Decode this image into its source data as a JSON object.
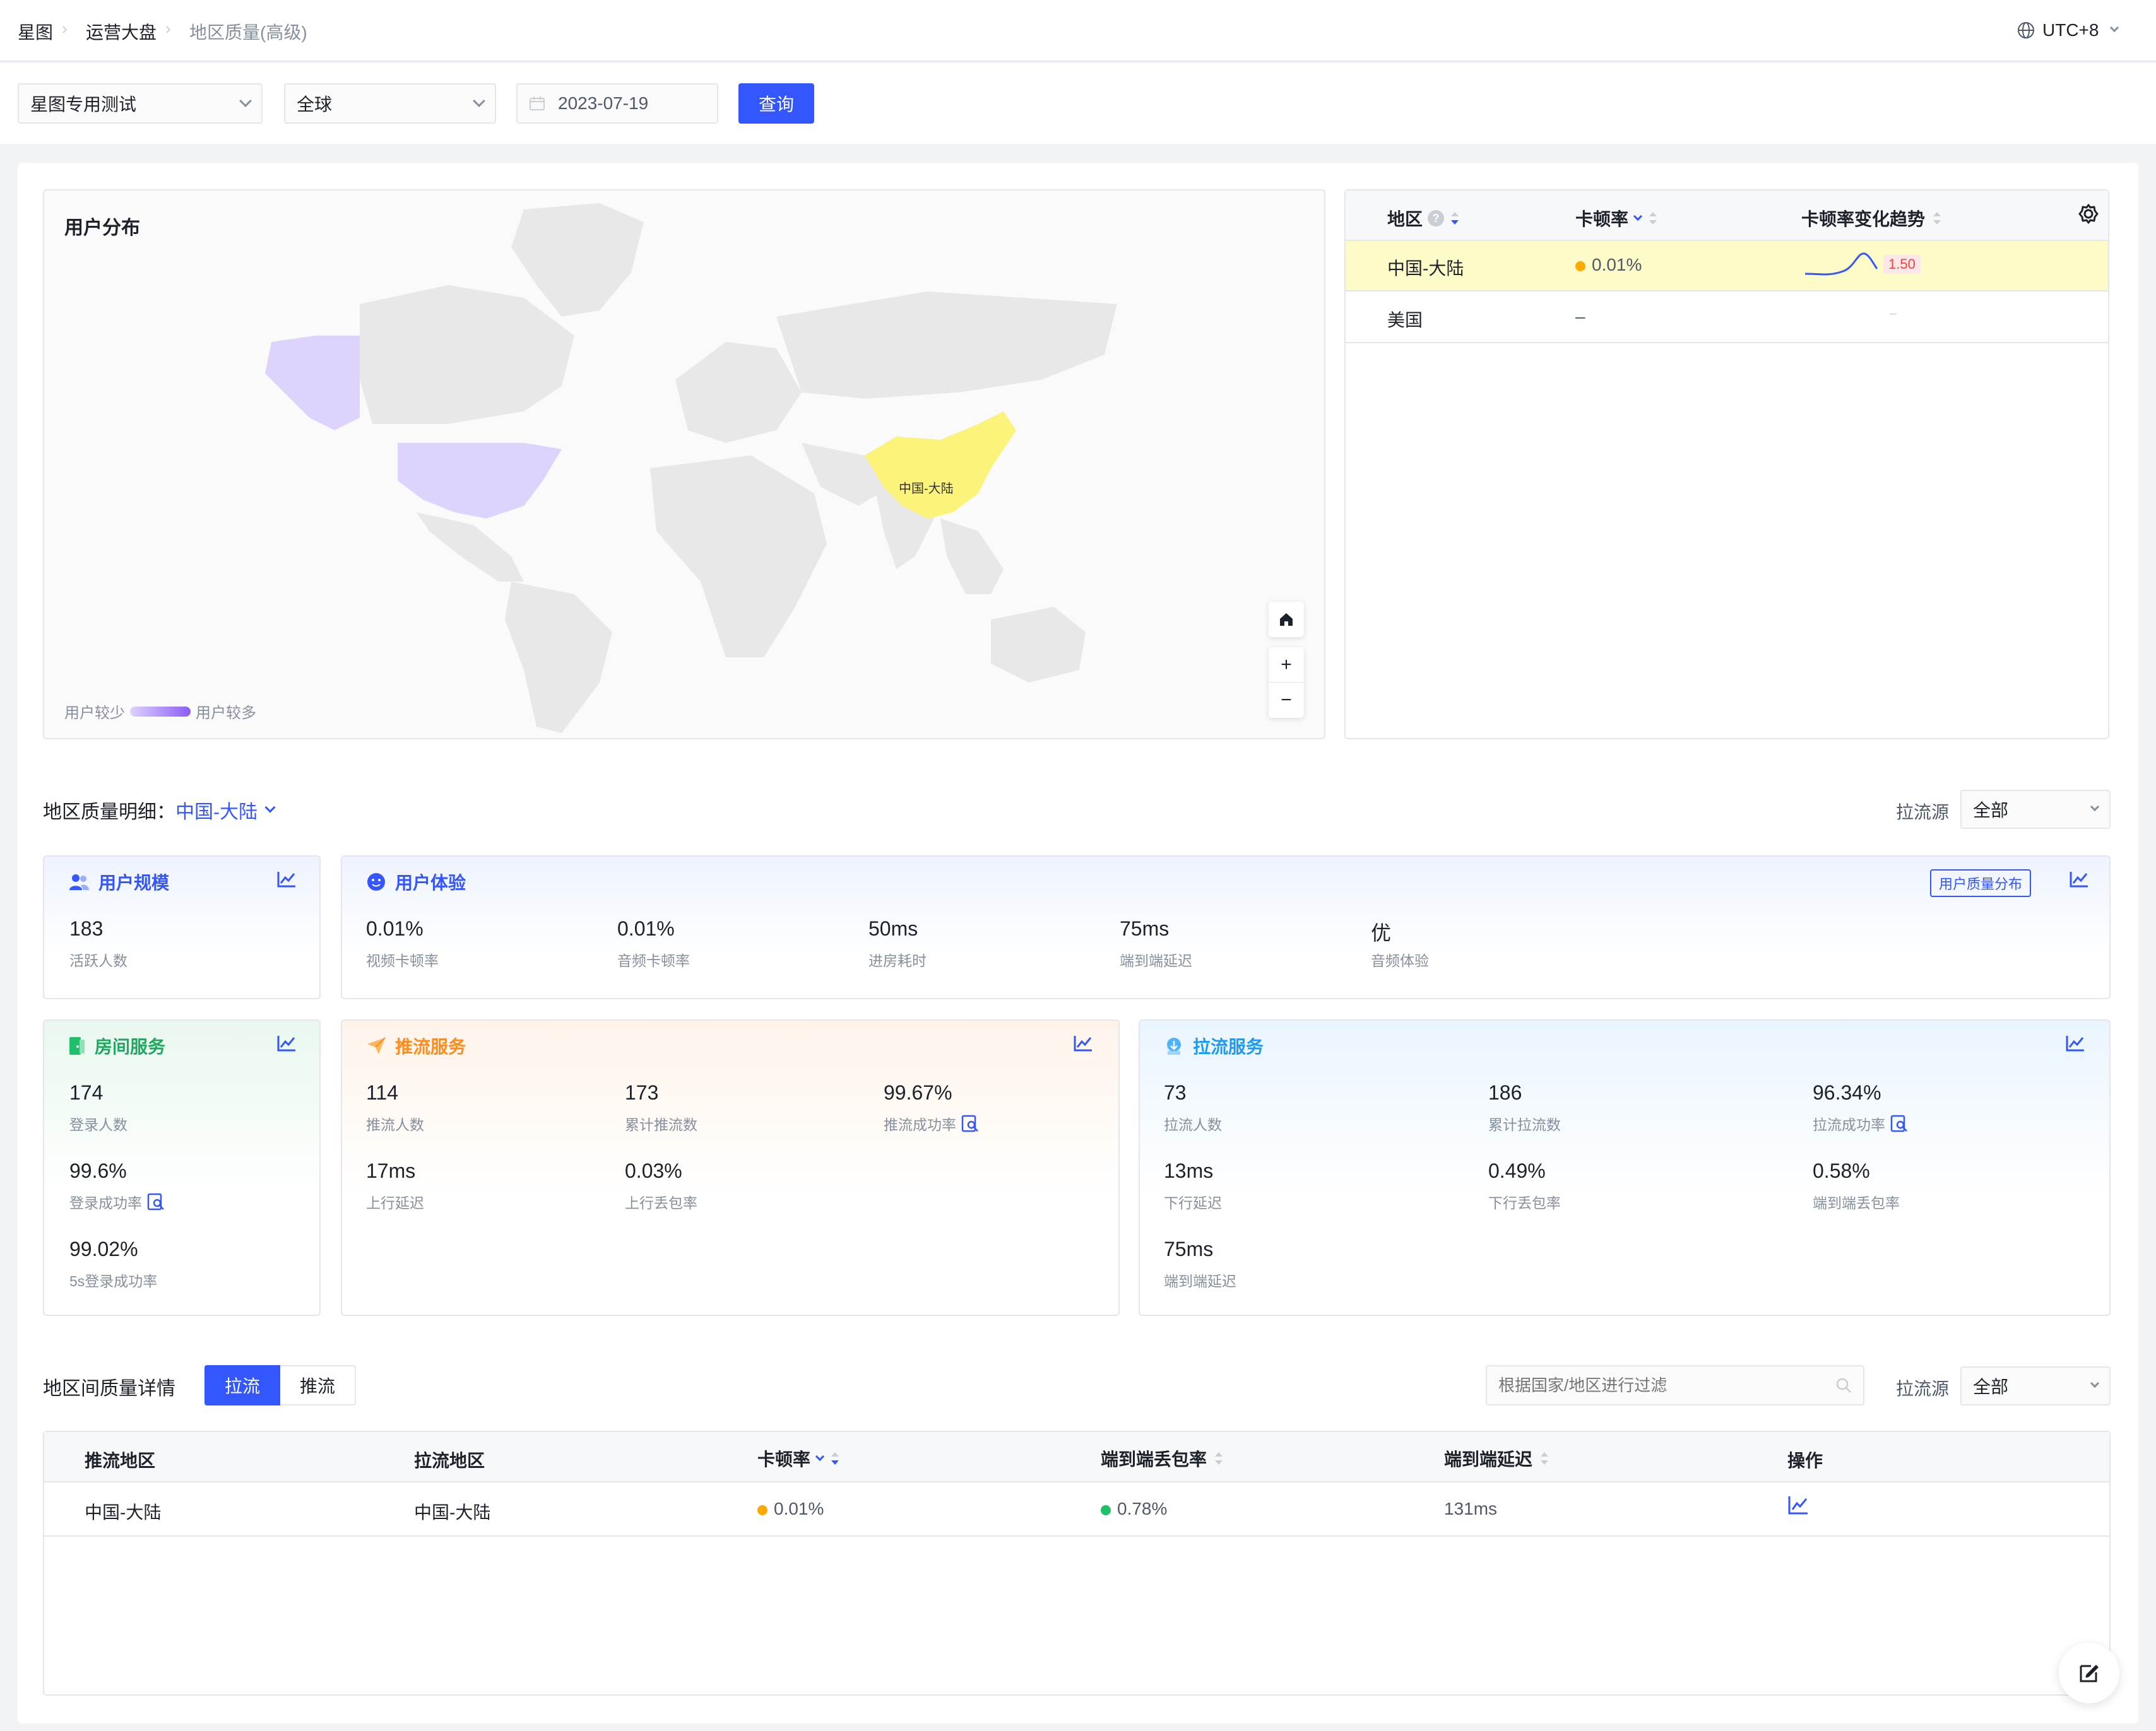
{
  "breadcrumb": {
    "items": [
      "星图",
      "运营大盘",
      "地区质量(高级)"
    ]
  },
  "timezone": "UTC+8",
  "filters": {
    "app": "星图专用测试",
    "region": "全球",
    "date": "2023-07-19",
    "query_button": "查询"
  },
  "map_card": {
    "title": "用户分布",
    "china_label": "中国-大陆",
    "legend_low": "用户较少",
    "legend_high": "用户较多",
    "zoom_in": "+",
    "zoom_out": "−"
  },
  "region_table": {
    "columns": [
      "地区",
      "卡顿率",
      "卡顿率变化趋势"
    ],
    "rows": [
      {
        "region": "中国-大陆",
        "rate": "0.01%",
        "trend": "1.50"
      },
      {
        "region": "美国",
        "rate": "–",
        "trend": "–"
      }
    ]
  },
  "detail": {
    "title": "地区质量明细：",
    "region": "中国-大陆",
    "pull_source_label": "拉流源",
    "pull_source_value": "全部"
  },
  "user_scale": {
    "title": "用户规模",
    "metrics": [
      {
        "value": "183",
        "label": "活跃人数"
      }
    ]
  },
  "user_experience": {
    "title": "用户体验",
    "dist_button": "用户质量分布",
    "metrics": [
      {
        "value": "0.01%",
        "label": "视频卡顿率"
      },
      {
        "value": "0.01%",
        "label": "音频卡顿率"
      },
      {
        "value": "50ms",
        "label": "进房耗时"
      },
      {
        "value": "75ms",
        "label": "端到端延迟"
      },
      {
        "value": "优",
        "label": "音频体验"
      }
    ]
  },
  "room_service": {
    "title": "房间服务",
    "metrics": [
      {
        "value": "174",
        "label": "登录人数"
      },
      {
        "value": "99.6%",
        "label": "登录成功率"
      },
      {
        "value": "99.02%",
        "label": "5s登录成功率"
      }
    ]
  },
  "push_service": {
    "title": "推流服务",
    "metrics": [
      {
        "value": "114",
        "label": "推流人数"
      },
      {
        "value": "173",
        "label": "累计推流数"
      },
      {
        "value": "99.67%",
        "label": "推流成功率"
      },
      {
        "value": "17ms",
        "label": "上行延迟"
      },
      {
        "value": "0.03%",
        "label": "上行丢包率"
      }
    ]
  },
  "pull_service": {
    "title": "拉流服务",
    "metrics": [
      {
        "value": "73",
        "label": "拉流人数"
      },
      {
        "value": "186",
        "label": "累计拉流数"
      },
      {
        "value": "96.34%",
        "label": "拉流成功率"
      },
      {
        "value": "13ms",
        "label": "下行延迟"
      },
      {
        "value": "0.49%",
        "label": "下行丢包率"
      },
      {
        "value": "0.58%",
        "label": "端到端丢包率"
      },
      {
        "value": "75ms",
        "label": "端到端延迟"
      }
    ]
  },
  "inter_region": {
    "title": "地区间质量详情",
    "tabs": [
      "拉流",
      "推流"
    ],
    "search_placeholder": "根据国家/地区进行过滤",
    "pull_source_label": "拉流源",
    "pull_source_value": "全部",
    "columns": [
      "推流地区",
      "拉流地区",
      "卡顿率",
      "端到端丢包率",
      "端到端延迟",
      "操作"
    ],
    "rows": [
      {
        "push": "中国-大陆",
        "pull": "中国-大陆",
        "rate": "0.01%",
        "loss": "0.78%",
        "delay": "131ms"
      }
    ]
  },
  "colors": {
    "primary": "#3456ff",
    "china": "#fbf37a",
    "usa": "#ddd3fc",
    "warn": "#ffa800",
    "ok": "#1fc06a"
  }
}
